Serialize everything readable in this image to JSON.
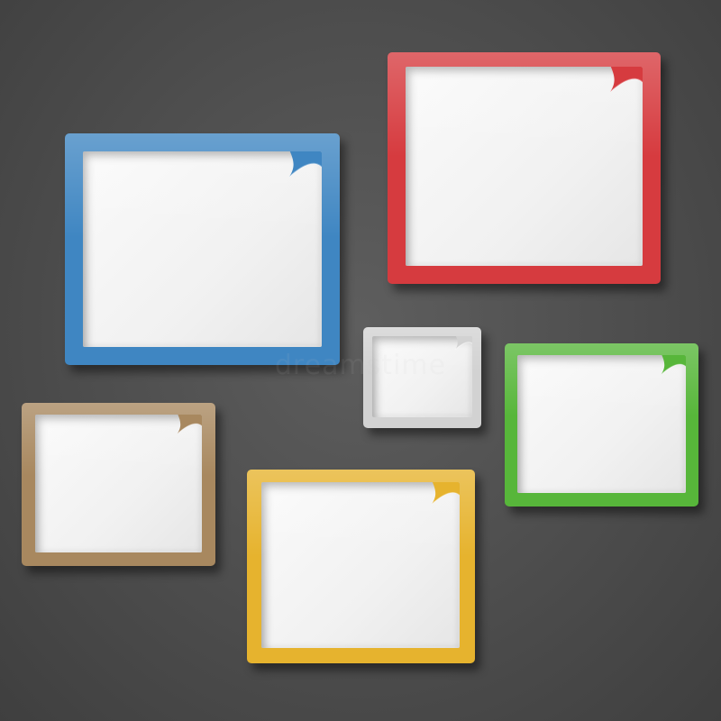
{
  "watermark": "dreamstime",
  "frames": [
    {
      "name": "blue-frame",
      "color": "#3f86c2"
    },
    {
      "name": "red-frame",
      "color": "#d63b3f"
    },
    {
      "name": "gray-frame",
      "color": "#d2d2d2"
    },
    {
      "name": "green-frame",
      "color": "#57b63a"
    },
    {
      "name": "tan-frame",
      "color": "#a8885f"
    },
    {
      "name": "yellow-frame",
      "color": "#e6b32e"
    }
  ]
}
